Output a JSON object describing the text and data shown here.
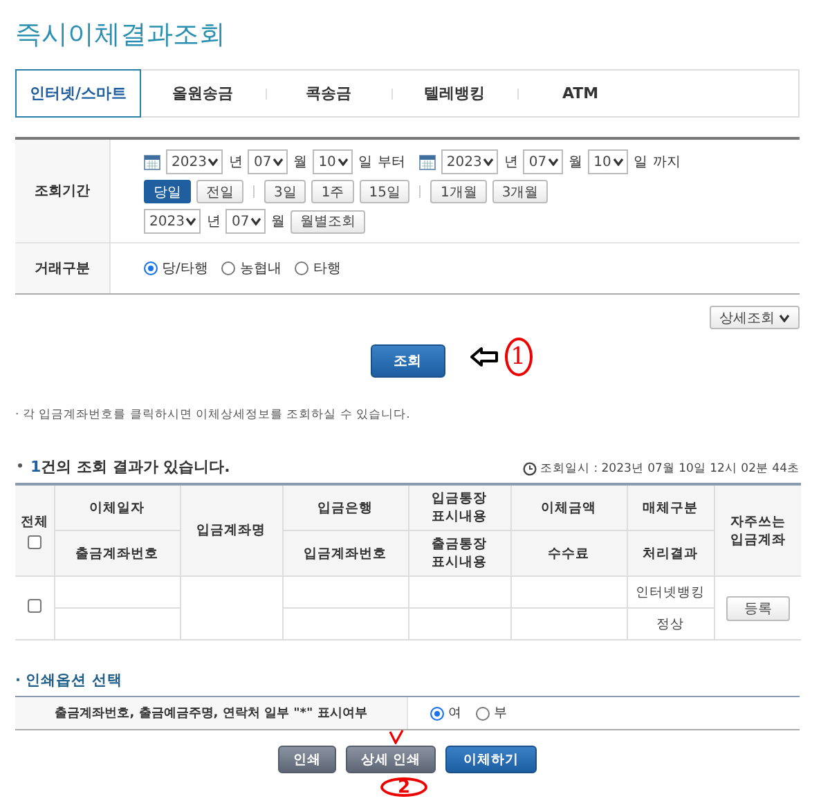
{
  "title": "즉시이체결과조회",
  "tabs": [
    {
      "label": "인터넷/스마트",
      "selected": true
    },
    {
      "label": "올원송금",
      "selected": false
    },
    {
      "label": "콕송금",
      "selected": false
    },
    {
      "label": "텔레뱅킹",
      "selected": false
    },
    {
      "label": "ATM",
      "selected": false
    }
  ],
  "search_form": {
    "period": {
      "label": "조회기간",
      "from": {
        "year": "2023",
        "year_unit": "년",
        "month": "07",
        "month_unit": "월",
        "day": "10",
        "day_unit": "일",
        "suffix": "부터"
      },
      "to": {
        "year": "2023",
        "year_unit": "년",
        "month": "07",
        "month_unit": "월",
        "day": "10",
        "day_unit": "일",
        "suffix": "까지"
      },
      "quick_button_groups": [
        [
          {
            "label": "당일",
            "selected": true
          },
          {
            "label": "전일",
            "selected": false
          }
        ],
        [
          {
            "label": "3일",
            "selected": false
          },
          {
            "label": "1주",
            "selected": false
          },
          {
            "label": "15일",
            "selected": false
          }
        ],
        [
          {
            "label": "1개월",
            "selected": false
          },
          {
            "label": "3개월",
            "selected": false
          }
        ]
      ],
      "monthly": {
        "year": "2023",
        "year_unit": "년",
        "month": "07",
        "month_unit": "월",
        "button": "월별조회"
      }
    },
    "transaction_type": {
      "label": "거래구분",
      "options": [
        {
          "label": "당/타행",
          "selected": true
        },
        {
          "label": "농협내",
          "selected": false
        },
        {
          "label": "타행",
          "selected": false
        }
      ]
    }
  },
  "detail_search_button": "상세조회",
  "search_button": "조회",
  "annotations": [
    {
      "kind": "arrow",
      "text": "1"
    },
    {
      "kind": "check",
      "text": "2"
    }
  ],
  "note": "· 각 입금계좌번호를 클릭하시면 이체상세정보를 조회하실 수 있습니다.",
  "results": {
    "count": "1",
    "summary": "건의 조회 결과가 있습니다.",
    "timestamp": "조회일시 : 2023년 07월 10일 12시 02분 44초",
    "select_all": {
      "label": "전체",
      "checked": false
    },
    "columns": [
      {
        "top": "이체일자",
        "bottom": "출금계좌번호"
      },
      {
        "single": "입금계좌명"
      },
      {
        "top": "입금은행",
        "bottom": "입금계좌번호"
      },
      {
        "top": "입금통장\n표시내용",
        "bottom": "출금통장\n표시내용"
      },
      {
        "top": "이체금액",
        "bottom": "수수료"
      },
      {
        "top": "매체구분",
        "bottom": "처리결과"
      },
      {
        "single": "자주쓰는\n입금계좌"
      }
    ],
    "rows": [
      {
        "checked": false,
        "channel": "인터넷뱅킹",
        "result": "정상",
        "register_button": "등록"
      }
    ]
  },
  "print_options": {
    "title": "· 인쇄옵션 선택",
    "rows": [
      {
        "label": "출금계좌번호, 출금예금주명, 연락처 일부 \"*\" 표시여부",
        "options": [
          {
            "label": "여",
            "selected": true
          },
          {
            "label": "부",
            "selected": false
          }
        ]
      }
    ]
  },
  "action_buttons": [
    {
      "label": "인쇄",
      "kind": "secondary"
    },
    {
      "label": "상세 인쇄",
      "kind": "secondary"
    },
    {
      "label": "이체하기",
      "kind": "primary"
    }
  ]
}
